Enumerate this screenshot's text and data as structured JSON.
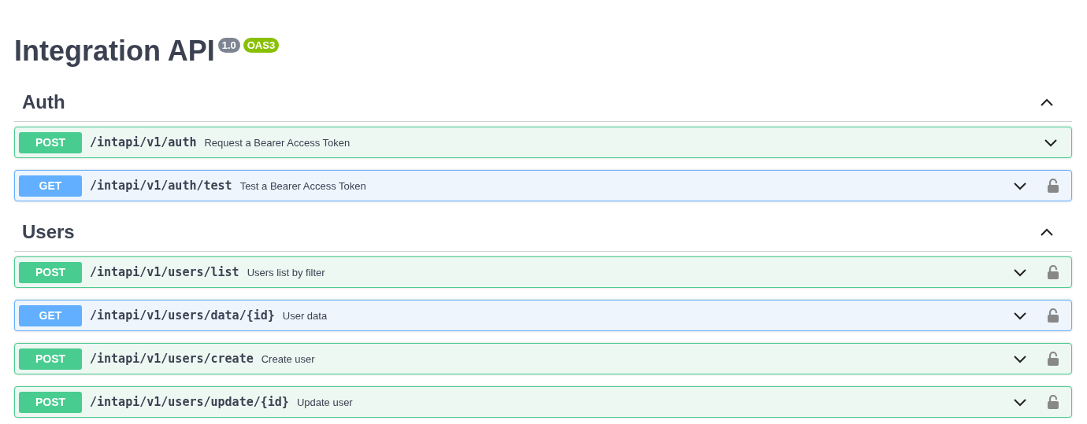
{
  "info": {
    "title": "Integration API",
    "version": "1.0",
    "spec": "OAS3"
  },
  "sections": [
    {
      "name": "Auth",
      "expanded": true,
      "operations": [
        {
          "method": "POST",
          "path": "/intapi/v1/auth",
          "summary": "Request a Bearer Access Token",
          "expanded": false,
          "secured": false
        },
        {
          "method": "GET",
          "path": "/intapi/v1/auth/test",
          "summary": "Test a Bearer Access Token",
          "expanded": false,
          "secured": true
        }
      ]
    },
    {
      "name": "Users",
      "expanded": true,
      "operations": [
        {
          "method": "POST",
          "path": "/intapi/v1/users/list",
          "summary": "Users list by filter",
          "expanded": false,
          "secured": true
        },
        {
          "method": "GET",
          "path": "/intapi/v1/users/data/{id}",
          "summary": "User data",
          "expanded": false,
          "secured": true
        },
        {
          "method": "POST",
          "path": "/intapi/v1/users/create",
          "summary": "Create user",
          "expanded": false,
          "secured": true
        },
        {
          "method": "POST",
          "path": "/intapi/v1/users/update/{id}",
          "summary": "Update user",
          "expanded": false,
          "secured": true
        }
      ]
    }
  ]
}
